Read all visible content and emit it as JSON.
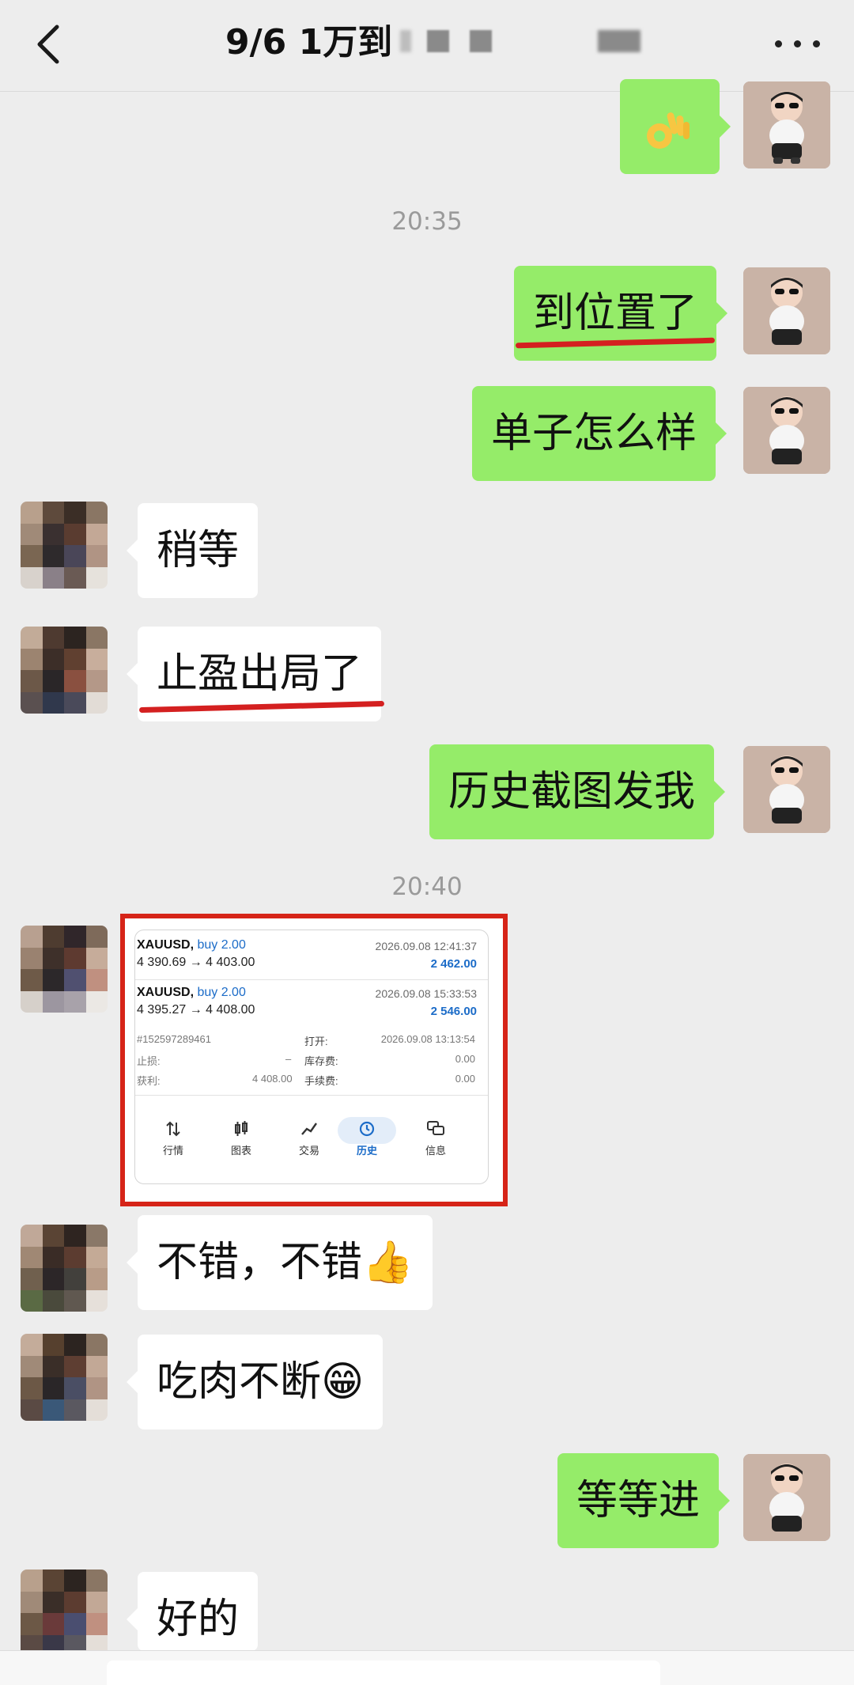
{
  "header": {
    "title": "9/6  1万到",
    "back_icon": "chevron-left-icon",
    "more_icon": "more-dots-icon"
  },
  "timestamps": [
    "20:35",
    "20:40"
  ],
  "messages": [
    {
      "side": "me",
      "text": "👌",
      "emoji_name": "ok-hand"
    },
    {
      "side": "me",
      "text": "到位置了"
    },
    {
      "side": "me",
      "text": "单子怎么样"
    },
    {
      "side": "other",
      "text": "稍等"
    },
    {
      "side": "other",
      "text": "止盈出局了"
    },
    {
      "side": "me",
      "text": "历史截图发我"
    },
    {
      "side": "other",
      "type": "image"
    },
    {
      "side": "other",
      "text": "不错，不错👍"
    },
    {
      "side": "other",
      "text": "吃肉不断😁"
    },
    {
      "side": "me",
      "text": "等等进"
    },
    {
      "side": "other",
      "text": "好的"
    }
  ],
  "screenshot": {
    "trade1": {
      "symbol": "XAUUSD,",
      "side": "buy 2.00",
      "prices": "4 390.69 → 4 403.00",
      "datetime": "2026.09.08 12:41:37",
      "profit": "2 462.00"
    },
    "trade2": {
      "symbol": "XAUUSD,",
      "side": "buy 2.00",
      "prices": "4 395.27 → 4 408.00",
      "datetime": "2026.09.08 15:33:53",
      "profit": "2 546.00"
    },
    "details": {
      "ticket": "#152597289461",
      "open_label": "打开:",
      "open_value": "2026.09.08 13:13:54",
      "sl_label": "止损:",
      "sl_value": "–",
      "swap_label": "库存费:",
      "swap_value": "0.00",
      "tp_label": "获利:",
      "tp_value": "4 408.00",
      "fee_label": "手续费:",
      "fee_value": "0.00"
    },
    "nav": [
      "行情",
      "图表",
      "交易",
      "历史",
      "信息"
    ],
    "nav_active": "历史"
  },
  "colors": {
    "bg": "#ededed",
    "bubble_me": "#95ec69",
    "bubble_other": "#ffffff",
    "highlight_red": "#d42020",
    "mt_blue": "#1c6cc8"
  }
}
